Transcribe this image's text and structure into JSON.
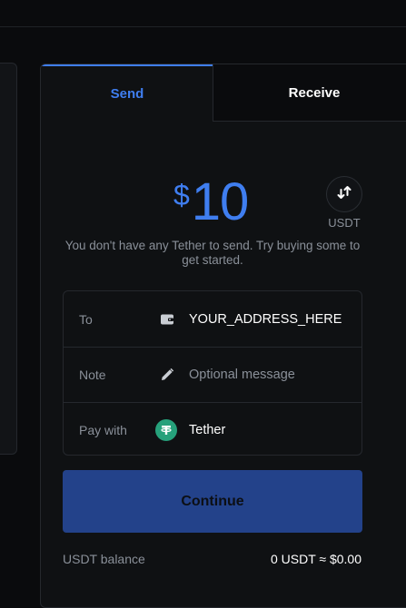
{
  "tabs": {
    "send": "Send",
    "receive": "Receive"
  },
  "amount": {
    "currency_symbol": "$",
    "value": "10"
  },
  "swap": {
    "icon": "swap-arrows-icon",
    "label": "USDT"
  },
  "notice": "You don't have any Tether to send. Try buying some to get started.",
  "form": {
    "to": {
      "label": "To",
      "icon": "wallet-icon",
      "value": "YOUR_ADDRESS_HERE"
    },
    "note": {
      "label": "Note",
      "icon": "pencil-icon",
      "placeholder": "Optional message"
    },
    "pay_with": {
      "label": "Pay with",
      "icon": "tether-icon",
      "value": "Tether"
    }
  },
  "continue_label": "Continue",
  "balance": {
    "label": "USDT balance",
    "value": "0 USDT ≈ $0.00"
  },
  "colors": {
    "accent": "#3f7ef0",
    "button": "#23428a",
    "tether": "#26a17b",
    "background": "#0a0b0d",
    "muted_text": "#8a9099"
  }
}
